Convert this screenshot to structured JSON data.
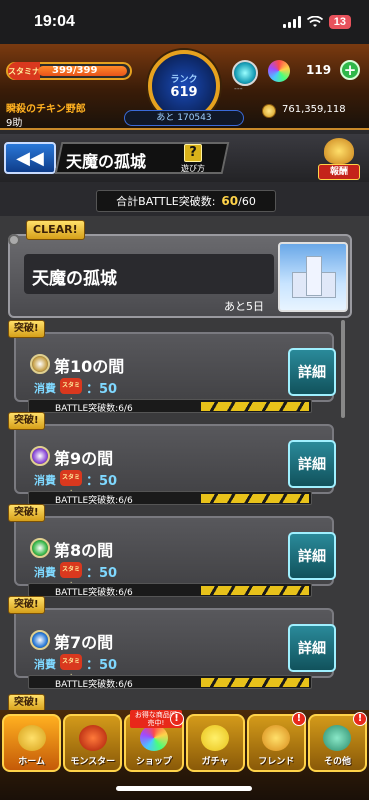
{
  "status_bar": {
    "time": "19:04",
    "battery": "13"
  },
  "header": {
    "stamina_tag": "スタミナ",
    "stamina": "399/399",
    "rank_label": "ランク",
    "rank_value": "619",
    "rank_next": "あと 170543",
    "orb_sub": "---",
    "gems": "119",
    "plus_label": "+",
    "player_name": "瞬殺のチキン野郎",
    "player_sub": "9助",
    "coins": "761,359,118"
  },
  "titlebar": {
    "back_label": "◀◀",
    "title": "天魔の孤城",
    "help_q": "?",
    "help_label": "遊び方",
    "reward_label": "報酬"
  },
  "summary": {
    "label": "合計BATTLE突破数:",
    "current": "60",
    "total": "/60"
  },
  "castle": {
    "clear": "CLEAR!",
    "name": "天魔の孤城",
    "remaining": "あと5日"
  },
  "floors": [
    {
      "breach": "突破!",
      "name": "第10の間",
      "cost_label": "消費",
      "cost_tag": "スタミナ",
      "cost": "：50",
      "progress": "BATTLE突破数:6/6",
      "detail": "詳細",
      "icon_color": "#c8a24a"
    },
    {
      "breach": "突破!",
      "name": "第9の間",
      "cost_label": "消費",
      "cost_tag": "スタミナ",
      "cost": "：50",
      "progress": "BATTLE突破数:6/6",
      "detail": "詳細",
      "icon_color": "#8a4ad8"
    },
    {
      "breach": "突破!",
      "name": "第8の間",
      "cost_label": "消費",
      "cost_tag": "スタミナ",
      "cost": "：50",
      "progress": "BATTLE突破数:6/6",
      "detail": "詳細",
      "icon_color": "#3ab84a"
    },
    {
      "breach": "突破!",
      "name": "第7の間",
      "cost_label": "消費",
      "cost_tag": "スタミナ",
      "cost": "：50",
      "progress": "BATTLE突破数:6/6",
      "detail": "詳細",
      "icon_color": "#2a7ad8"
    }
  ],
  "next_breach": "突破!",
  "nav": {
    "home": "ホーム",
    "monster": "モンスター",
    "shop": "ショップ",
    "shop_sale": "お得な商品販売中!",
    "gacha": "ガチャ",
    "friend": "フレンド",
    "other": "その他",
    "alert": "!"
  }
}
